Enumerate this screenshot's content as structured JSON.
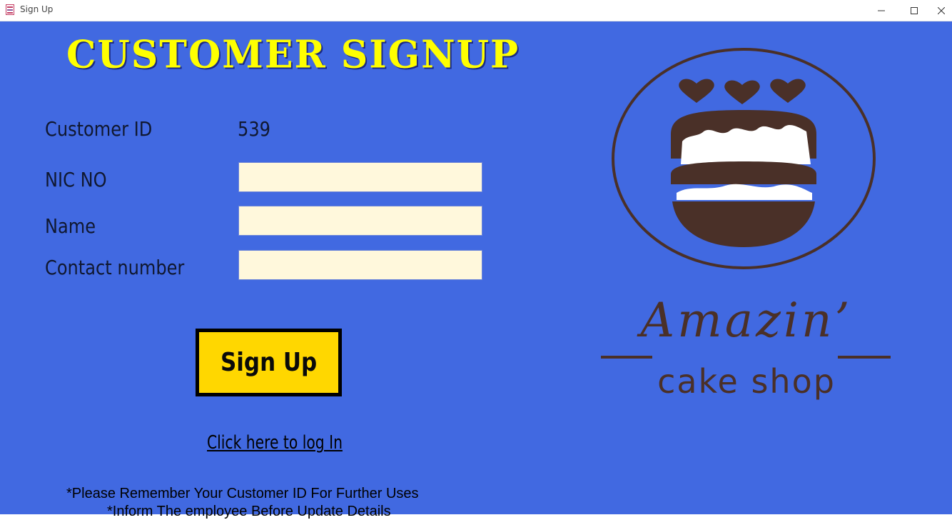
{
  "window": {
    "title": "Sign Up",
    "app_icon": "cake-app-icon",
    "controls": {
      "minimize": "minimize-icon",
      "maximize": "maximize-icon",
      "close": "close-icon"
    }
  },
  "form": {
    "title": "CUSTOMER SIGNUP",
    "customer_id_label": "Customer ID",
    "customer_id_value": "539",
    "nic_label": "NIC NO",
    "nic_value": "",
    "name_label": "Name",
    "name_value": "",
    "contact_label": "Contact number",
    "contact_value": "",
    "signup_button": "Sign Up",
    "login_link": "Click here to log In",
    "note_1": "*Please Remember Your Customer ID For Further Uses",
    "note_2": "*Inform The employee Before Update Details"
  },
  "logo": {
    "name": "Amazin’",
    "subtitle": "cake shop",
    "icon": "cake-logo-icon"
  },
  "colors": {
    "background": "#4169e1",
    "title": "#ffff00",
    "field": "#fff8dc",
    "button": "#ffd700",
    "logo": "#4a3028"
  }
}
